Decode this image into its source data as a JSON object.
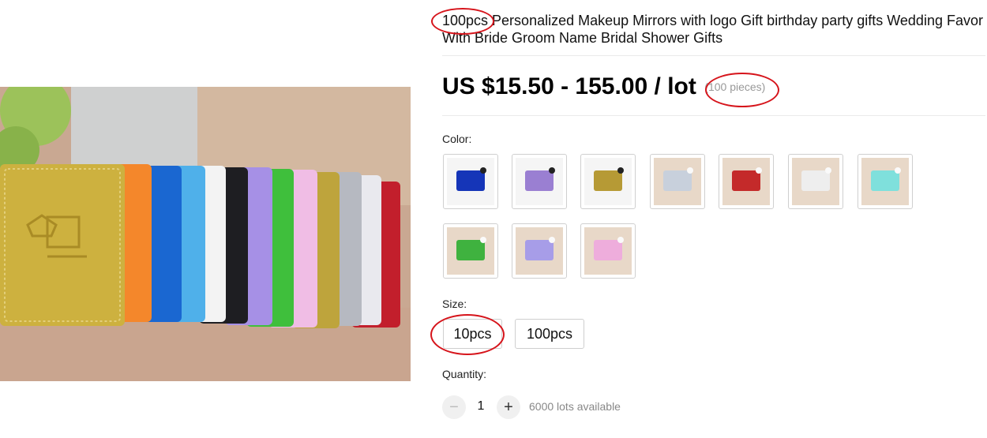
{
  "product": {
    "title": "100pcs Personalized Makeup Mirrors with logo Gift birthday party gifts Wedding Favor With Bride Groom Name Bridal Shower Gifts",
    "price": "US $15.50 - 155.00 / lot",
    "pieces_note": "(100 pieces)"
  },
  "color": {
    "label": "Color:",
    "swatches": [
      {
        "icon": "blue-mirror-icon",
        "color": "#1535b8"
      },
      {
        "icon": "purple-mirror-icon",
        "color": "#9a7fd2"
      },
      {
        "icon": "gold-mirror-icon",
        "color": "#b69a35"
      },
      {
        "icon": "silver-mirror-icon",
        "color": "#c8d0dc"
      },
      {
        "icon": "red-mirror-icon",
        "color": "#c42a2a"
      },
      {
        "icon": "white-mirror-icon",
        "color": "#eeeeee"
      },
      {
        "icon": "teal-mirror-icon",
        "color": "#7fe0dc"
      },
      {
        "icon": "green-mirror-icon",
        "color": "#3fb23f"
      },
      {
        "icon": "lavender-mirror-icon",
        "color": "#a79de8"
      },
      {
        "icon": "pink-mirror-icon",
        "color": "#eeaddc"
      }
    ]
  },
  "size": {
    "label": "Size:",
    "options": [
      "10pcs",
      "100pcs"
    ]
  },
  "quantity": {
    "label": "Quantity:",
    "minus": "−",
    "value": "1",
    "plus": "+",
    "availability": "6000 lots available"
  },
  "accent_colors": {
    "annotation": "#d6141b",
    "muted_text": "#888888"
  }
}
